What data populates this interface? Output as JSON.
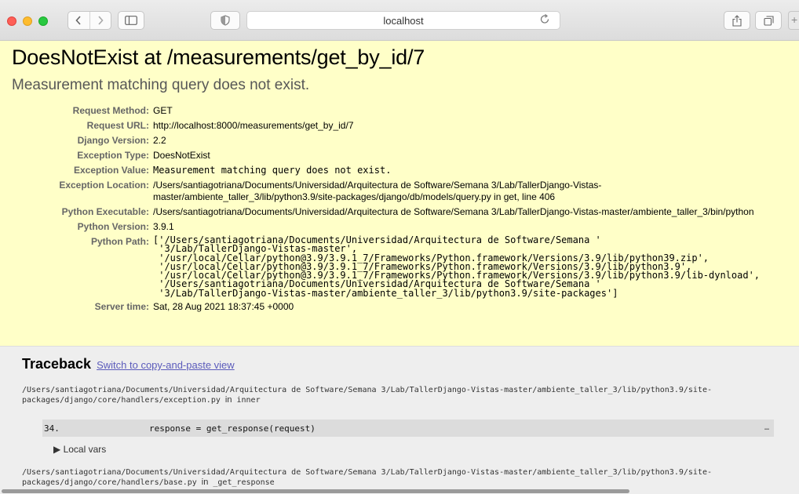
{
  "browser": {
    "url": "localhost",
    "icons": {
      "back": "chevron-left-icon",
      "forward": "chevron-right-icon",
      "sidebar": "sidebar-icon",
      "privacy": "shield-icon",
      "reload": "reload-icon",
      "share": "share-icon",
      "tabs": "tabs-icon",
      "new_tab": "plus-icon"
    },
    "new_tab_label": "+"
  },
  "error": {
    "title": "DoesNotExist at /measurements/get_by_id/7",
    "subtitle": "Measurement matching query does not exist."
  },
  "meta": [
    {
      "label": "Request Method:",
      "value": "GET",
      "style": "plain"
    },
    {
      "label": "Request URL:",
      "value": "http://localhost:8000/measurements/get_by_id/7",
      "style": "plain"
    },
    {
      "label": "Django Version:",
      "value": "2.2",
      "style": "plain"
    },
    {
      "label": "Exception Type:",
      "value": "DoesNotExist",
      "style": "plain"
    },
    {
      "label": "Exception Value:",
      "value": "Measurement matching query does not exist.",
      "style": "mono"
    },
    {
      "label": "Exception Location:",
      "value": "/Users/santiagotriana/Documents/Universidad/Arquitectura de Software/Semana 3/Lab/TallerDjango-Vistas-master/ambiente_taller_3/lib/python3.9/site-packages/django/db/models/query.py in get, line 406",
      "style": "plain"
    },
    {
      "label": "Python Executable:",
      "value": "/Users/santiagotriana/Documents/Universidad/Arquitectura de Software/Semana 3/Lab/TallerDjango-Vistas-master/ambiente_taller_3/bin/python",
      "style": "plain"
    },
    {
      "label": "Python Version:",
      "value": "3.9.1",
      "style": "plain"
    },
    {
      "label": "Python Path:",
      "value": "['/Users/santiagotriana/Documents/Universidad/Arquitectura de Software/Semana '\n '3/Lab/TallerDjango-Vistas-master',\n '/usr/local/Cellar/python@3.9/3.9.1_7/Frameworks/Python.framework/Versions/3.9/lib/python39.zip',\n '/usr/local/Cellar/python@3.9/3.9.1_7/Frameworks/Python.framework/Versions/3.9/lib/python3.9',\n '/usr/local/Cellar/python@3.9/3.9.1_7/Frameworks/Python.framework/Versions/3.9/lib/python3.9/lib-dynload',\n '/Users/santiagotriana/Documents/Universidad/Arquitectura de Software/Semana '\n '3/Lab/TallerDjango-Vistas-master/ambiente_taller_3/lib/python3.9/site-packages']",
      "style": "pre"
    },
    {
      "label": "Server time:",
      "value": "Sat, 28 Aug 2021 18:37:45 +0000",
      "style": "plain"
    }
  ],
  "traceback": {
    "heading": "Traceback",
    "switch_link": "Switch to copy-and-paste view",
    "frames": [
      {
        "path": "/Users/santiagotriana/Documents/Universidad/Arquitectura de Software/Semana 3/Lab/TallerDjango-Vistas-master/ambiente_taller_3/lib/python3.9/site-packages/django/core/handlers/exception.py",
        "in_word": "in",
        "function": "inner",
        "line_number": "34.",
        "code": "response = get_response(request)",
        "ellipsis": "…",
        "local_vars": "▶ Local vars"
      },
      {
        "path": "/Users/santiagotriana/Documents/Universidad/Arquitectura de Software/Semana 3/Lab/TallerDjango-Vistas-master/ambiente_taller_3/lib/python3.9/site-packages/django/core/handlers/base.py",
        "in_word": "in",
        "function": "_get_response"
      }
    ]
  },
  "colors": {
    "summary_bg": "#ffffc8",
    "traceback_bg": "#eeeeee",
    "code_bg": "#dcdcdc",
    "link": "#5b5bbb"
  }
}
